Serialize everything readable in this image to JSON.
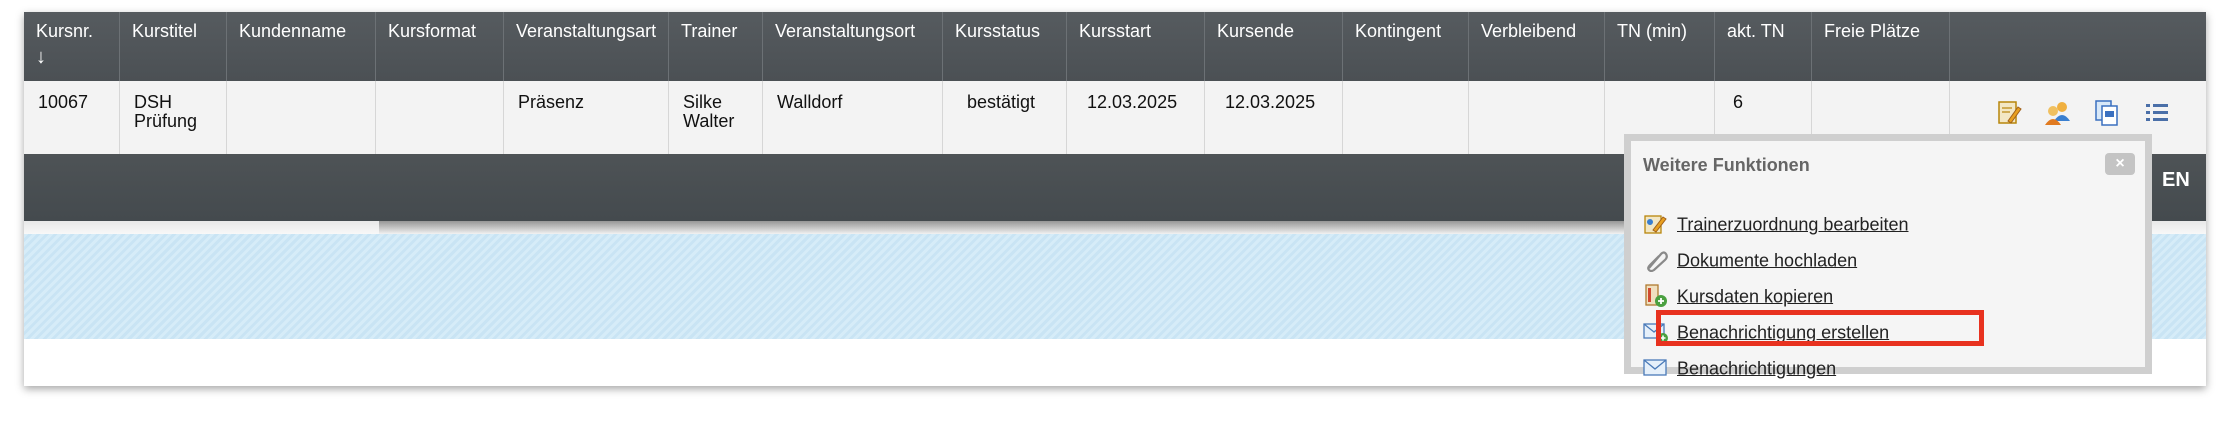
{
  "table": {
    "headers": [
      {
        "label": "Kursnr.",
        "sub": "↓"
      },
      {
        "label": "Kurstitel"
      },
      {
        "label": "Kundenname"
      },
      {
        "label": "Kursformat"
      },
      {
        "label": "Veranstaltungsart"
      },
      {
        "label": "Trainer"
      },
      {
        "label": "Veranstaltungsort"
      },
      {
        "label": "Kursstatus"
      },
      {
        "label": "Kursstart"
      },
      {
        "label": "Kursende"
      },
      {
        "label": "Kontingent"
      },
      {
        "label": "Verbleibend"
      },
      {
        "label": "TN (min)"
      },
      {
        "label": "akt. TN"
      },
      {
        "label": "Freie Plätze"
      },
      {
        "label": ""
      }
    ],
    "row": {
      "kursnr": "10067",
      "kurstitel_line1": "DSH",
      "kurstitel_line2": "Prüfung",
      "kundenname": "",
      "kursformat": "",
      "veranstaltungsart": "Präsenz",
      "trainer_line1": "Silke",
      "trainer_line2": "Walter",
      "veranstaltungsort": "Walldorf",
      "kursstatus": "bestätigt",
      "kursstart": "12.03.2025",
      "kursende": "12.03.2025",
      "kontingent": "",
      "verbleibend": "",
      "tn_min": "",
      "akt_tn": "6",
      "freie_plaetze": ""
    },
    "row_actions": [
      "edit-icon",
      "users-icon",
      "copy-icon",
      "list-icon"
    ]
  },
  "band": {
    "right_label": "EN"
  },
  "popup": {
    "title": "Weitere Funktionen",
    "close": "×",
    "items": [
      {
        "label": "Trainerzuordnung bearbeiten",
        "icon": "trainer-edit-icon"
      },
      {
        "label": "Dokumente hochladen",
        "icon": "paperclip-icon"
      },
      {
        "label": "Kursdaten kopieren",
        "icon": "copy-data-icon"
      },
      {
        "label": "Benachrichtigung erstellen",
        "icon": "mail-add-icon",
        "highlighted": true
      },
      {
        "label": "Benachrichtigungen",
        "icon": "mail-icon"
      }
    ]
  },
  "colors": {
    "header_bg": "#4e5357",
    "highlight": "#e8321f",
    "blue_band": "#d6ecf8"
  }
}
